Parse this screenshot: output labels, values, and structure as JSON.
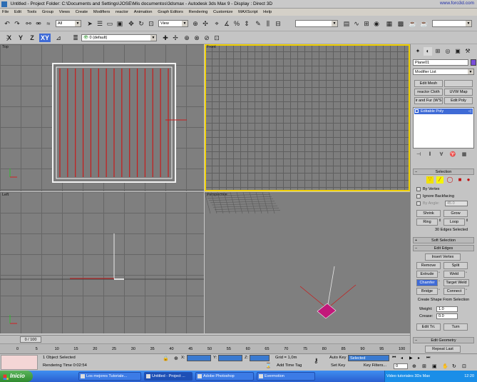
{
  "window": {
    "title": "Untitled    - Project Folder: C:\\Documents and Settings\\JOSE\\Mis documentos\\3dsmax    - Autodesk 3ds Max 9    - Display : Direct 3D",
    "watermark": "www.foro3d.com"
  },
  "menu": [
    "File",
    "Edit",
    "Tools",
    "Group",
    "Views",
    "Create",
    "Modifiers",
    "reactor",
    "Animation",
    "Graph Editors",
    "Rendering",
    "Customize",
    "MAXScript",
    "Help"
  ],
  "toolbar": {
    "selection_filter": "All",
    "ref_coord": "View",
    "named_sel": "",
    "axis": [
      "X",
      "Y",
      "Z",
      "XY"
    ],
    "layer": "0 (default)"
  },
  "viewports": {
    "top": "Top",
    "front": "Front",
    "left": "Left",
    "perspective": "Perspective"
  },
  "command_panel": {
    "object_name": "Plane01",
    "modifier_list": "Modifier List",
    "mod_buttons": [
      "Edit Mesh",
      "",
      "reactor Cloth",
      "UVW Map",
      "ir and Fur (W'S",
      "Edit Poly"
    ],
    "stack_item": "Editable Poly",
    "selection": {
      "title": "Selection",
      "by_vertex": "By Vertex",
      "ignore_backfacing": "Ignore Backfacing",
      "by_angle": "By Angle:",
      "by_angle_val": "45.0",
      "shrink": "Shrink",
      "grow": "Grow",
      "ring": "Ring",
      "loop": "Loop",
      "status": "30 Edges Selected"
    },
    "soft_selection": "Soft Selection",
    "edit_edges": {
      "title": "Edit Edges",
      "insert_vertex": "Insert Vertex",
      "remove": "Remove",
      "split": "Split",
      "extrude": "Extrude",
      "weld": "Weld",
      "chamfer": "Chamfer",
      "target_weld": "Target Weld",
      "bridge": "Bridge",
      "connect": "Connect",
      "create_shape": "Create Shape From Selection",
      "weight_label": "Weight:",
      "weight_val": "1.0",
      "crease_label": "Crease:",
      "crease_val": "0.0",
      "edit_tri": "Edit Tri.",
      "turn": "Turn"
    },
    "edit_geometry": "Edit Geometry",
    "repeat_last": "Repeat Last"
  },
  "timeline": {
    "slider": "0 / 100",
    "ticks": [
      "0",
      "5",
      "10",
      "15",
      "20",
      "25",
      "30",
      "35",
      "40",
      "45",
      "50",
      "55",
      "60",
      "65",
      "70",
      "75",
      "80",
      "85",
      "90",
      "95",
      "100"
    ]
  },
  "status": {
    "objects_selected": "1 Object Selected",
    "render_time": "Rendering Time  0:02:54",
    "x_label": "X:",
    "x_val": "",
    "y_label": "Y:",
    "y_val": "",
    "z_label": "Z:",
    "z_val": "",
    "grid": "Grid = 1,0m",
    "add_time_tag": "Add Time Tag",
    "auto_key": "Auto Key",
    "auto_key_val": "Selected",
    "set_key": "Set Key",
    "key_filters": "Key Filters...",
    "frame": "0"
  },
  "taskbar": {
    "start": "Inicio",
    "tasks": [
      "Los mejores Tutoriale...",
      "Untitled - Project ...",
      "Adobe Photoshop",
      "Evermotion"
    ],
    "tray_text": "Video tutoriales 3Ds Max",
    "clock": "12:20"
  },
  "colors": {
    "accent": "#3f6bd6",
    "edge_red": "#c81b1b",
    "viewport_bg": "#7e7e7e",
    "active_border": "#f0d000",
    "object_pink": "#c2187a"
  }
}
